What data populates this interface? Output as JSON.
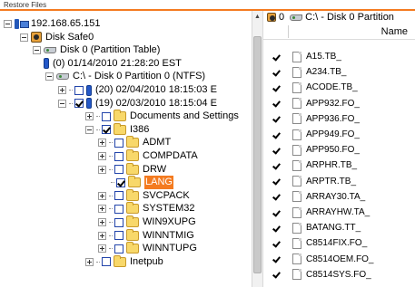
{
  "caption": "Restore Files",
  "tree": [
    {
      "label": "192.168.65.151",
      "expander": "minus",
      "checkbox": "none",
      "icon": "computer-icon",
      "depth": 0
    },
    {
      "label": "Disk Safe0",
      "expander": "minus",
      "checkbox": "none",
      "icon": "disk-safe-icon",
      "depth": 1
    },
    {
      "label": "Disk 0 (Partition Table)",
      "expander": "minus",
      "checkbox": "none",
      "icon": "drive-icon",
      "depth": 2
    },
    {
      "label": "(0) 01/14/2010 21:28:20 EST",
      "expander": "none",
      "checkbox": "none",
      "icon": "snapshot-icon",
      "depth": 3
    },
    {
      "label": "C:\\ - Disk 0 Partition 0 (NTFS)",
      "expander": "minus",
      "checkbox": "none",
      "icon": "drive-icon",
      "depth": 3
    },
    {
      "label": "(20) 02/04/2010 18:15:03 E",
      "expander": "plus",
      "checkbox": "unchecked",
      "icon": "snapshot-icon",
      "depth": 4
    },
    {
      "label": "(19) 02/03/2010 18:15:04 E",
      "expander": "minus",
      "checkbox": "checked",
      "icon": "snapshot-icon",
      "depth": 4
    },
    {
      "label": "Documents and Settings",
      "expander": "plus",
      "checkbox": "unchecked",
      "icon": "folder-icon",
      "depth": 5
    },
    {
      "label": "I386",
      "expander": "minus",
      "checkbox": "checked",
      "icon": "folder-icon",
      "depth": 5
    },
    {
      "label": "ADMT",
      "expander": "plus",
      "checkbox": "unchecked",
      "icon": "folder-icon",
      "depth": 6
    },
    {
      "label": "COMPDATA",
      "expander": "plus",
      "checkbox": "unchecked",
      "icon": "folder-icon",
      "depth": 6
    },
    {
      "label": "DRW",
      "expander": "plus",
      "checkbox": "unchecked",
      "icon": "folder-icon",
      "depth": 6
    },
    {
      "label": "LANG",
      "expander": "none",
      "checkbox": "checked",
      "icon": "folder-icon",
      "depth": 6,
      "selected": true
    },
    {
      "label": "SVCPACK",
      "expander": "plus",
      "checkbox": "unchecked",
      "icon": "folder-icon",
      "depth": 6
    },
    {
      "label": "SYSTEM32",
      "expander": "plus",
      "checkbox": "unchecked",
      "icon": "folder-icon",
      "depth": 6
    },
    {
      "label": "WIN9XUPG",
      "expander": "plus",
      "checkbox": "unchecked",
      "icon": "folder-icon",
      "depth": 6
    },
    {
      "label": "WINNTMIG",
      "expander": "plus",
      "checkbox": "unchecked",
      "icon": "folder-icon",
      "depth": 6
    },
    {
      "label": "WINNTUPG",
      "expander": "plus",
      "checkbox": "unchecked",
      "icon": "folder-icon",
      "depth": 6
    },
    {
      "label": "Inetpub",
      "expander": "plus",
      "checkbox": "unchecked",
      "icon": "folder-icon",
      "depth": 5
    }
  ],
  "right": {
    "address_prefix": "0",
    "address_path": "C:\\ - Disk 0 Partition",
    "column_name": "Name",
    "files": [
      "A15.TB_",
      "A234.TB_",
      "ACODE.TB_",
      "APP932.FO_",
      "APP936.FO_",
      "APP949.FO_",
      "APP950.FO_",
      "ARPHR.TB_",
      "ARPTR.TB_",
      "ARRAY30.TA_",
      "ARRAYHW.TA_",
      "BATANG.TT_",
      "C8514FIX.FO_",
      "C8514OEM.FO_",
      "C8514SYS.FO_"
    ]
  },
  "colors": {
    "accent": "#f47b20",
    "selection": "#f47b20",
    "checkbox_border": "#2244aa"
  }
}
